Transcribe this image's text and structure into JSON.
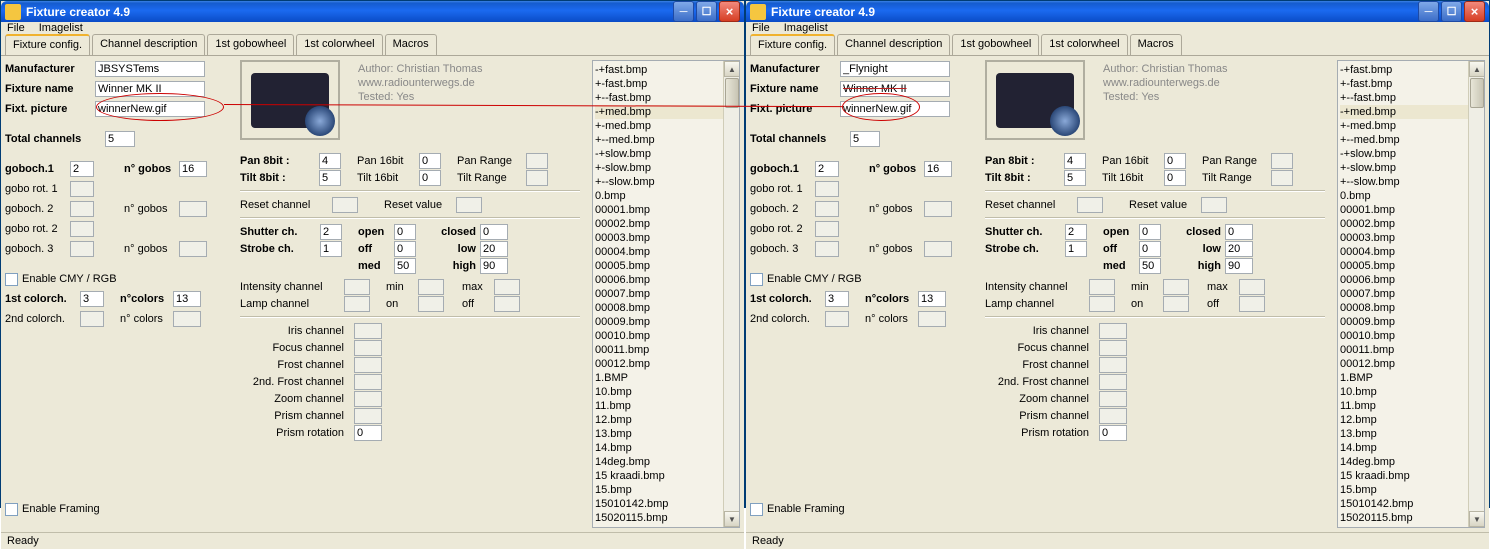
{
  "appTitle": "Fixture creator 4.9",
  "menu": {
    "file": "File",
    "imagelist": "Imagelist"
  },
  "tabs": {
    "fixtureConfig": "Fixture config.",
    "channelDesc": "Channel description",
    "gobowheel1": "1st gobowheel",
    "colorwheel1": "1st colorwheel",
    "macros": "Macros"
  },
  "labels": {
    "manufacturer": "Manufacturer",
    "fixtureName": "Fixture name",
    "fixtPicture": "Fixt. picture",
    "totalChannels": "Total channels",
    "goboch1": "goboch.1",
    "goboRot1": "gobo rot. 1",
    "nGobos": "n° gobos",
    "goboch2": "goboch. 2",
    "goboRot2": "gobo rot. 2",
    "goboch3": "goboch. 3",
    "enableCMY": "Enable CMY / RGB",
    "colorch1": "1st colorch.",
    "colorch2": "2nd colorch.",
    "nColors": "n°colors",
    "nColors2": "n° colors",
    "enableFraming": "Enable Framing",
    "pan8": "Pan 8bit :",
    "tilt8": "Tilt 8bit :",
    "pan16": "Pan 16bit",
    "tilt16": "Tilt 16bit",
    "panRange": "Pan Range",
    "tiltRange": "Tilt Range",
    "resetChannel": "Reset channel",
    "resetValue": "Reset value",
    "shutterCh": "Shutter ch.",
    "strobeCh": "Strobe ch.",
    "open": "open",
    "off": "off",
    "med": "med",
    "closed": "closed",
    "low": "low",
    "high": "high",
    "intensityCh": "Intensity channel",
    "lampCh": "Lamp channel",
    "min": "min",
    "on": "on",
    "max": "max",
    "offL": "off",
    "irisCh": "Iris channel",
    "focusCh": "Focus channel",
    "frostCh": "Frost channel",
    "frost2Ch": "2nd. Frost channel",
    "zoomCh": "Zoom channel",
    "prismCh": "Prism channel",
    "prismRot": "Prism rotation"
  },
  "author": {
    "line1": "Author: Christian Thomas",
    "line2": "www.radiounterwegs.de",
    "line3": "Tested: Yes"
  },
  "left": {
    "manufacturer": "JBSYSTems",
    "fixtureName": "Winner MK II",
    "fixtPicture": "winnerNew.gif",
    "totalChannels": "5",
    "goboch1": "2",
    "nGobos1": "16",
    "colorch1": "3",
    "nColors1": "13",
    "pan8": "4",
    "tilt8": "5",
    "pan16": "0",
    "tilt16": "0",
    "shutter": "2",
    "strobe": "1",
    "open": "0",
    "off": "0",
    "med": "50",
    "closed": "0",
    "low": "20",
    "high": "90",
    "prismRot": "0"
  },
  "right": {
    "manufacturer": "_Flynight",
    "fixtureName": "Winner MK II",
    "fixtPicture": "winnerNew.gif",
    "totalChannels": "5",
    "goboch1": "2",
    "nGobos1": "16",
    "colorch1": "3",
    "nColors1": "13",
    "pan8": "4",
    "tilt8": "5",
    "pan16": "0",
    "tilt16": "0",
    "shutter": "2",
    "strobe": "1",
    "open": "0",
    "off": "0",
    "med": "50",
    "closed": "0",
    "low": "20",
    "high": "90",
    "prismRot": "0"
  },
  "filelist": [
    "-+fast.bmp",
    "+-fast.bmp",
    "+--fast.bmp",
    "-+med.bmp",
    "+-med.bmp",
    "+--med.bmp",
    "-+slow.bmp",
    "+-slow.bmp",
    "+--slow.bmp",
    "0.bmp",
    "00001.bmp",
    "00002.bmp",
    "00003.bmp",
    "00004.bmp",
    "00005.bmp",
    "00006.bmp",
    "00007.bmp",
    "00008.bmp",
    "00009.bmp",
    "00010.bmp",
    "00011.bmp",
    "00012.bmp",
    "1.BMP",
    "10.bmp",
    "11.bmp",
    "12.bmp",
    "13.bmp",
    "14.bmp",
    "14deg.bmp",
    "15 kraadi.bmp",
    "15.bmp",
    "15010142.bmp",
    "15020115.bmp"
  ],
  "selectedFile": "-+med.bmp",
  "status": "Ready"
}
